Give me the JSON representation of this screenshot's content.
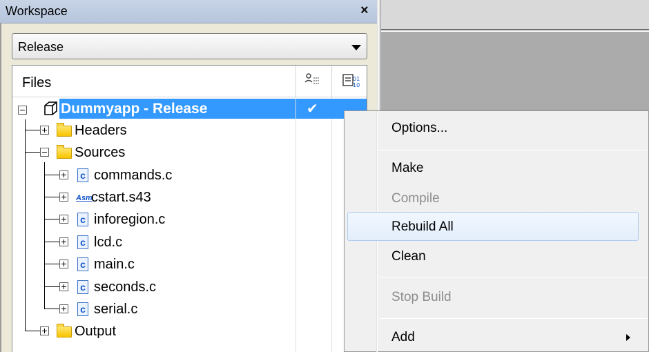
{
  "workspace": {
    "title": "Workspace",
    "close_glyph": "×",
    "configuration": "Release",
    "files_header": "Files",
    "project": {
      "label": "Dummyapp - Release",
      "checked": "✔"
    },
    "tree": [
      {
        "label": "Headers"
      },
      {
        "label": "Sources"
      },
      {
        "label": "commands.c"
      },
      {
        "label": "cstart.s43"
      },
      {
        "label": "inforegion.c"
      },
      {
        "label": "lcd.c"
      },
      {
        "label": "main.c"
      },
      {
        "label": "seconds.c"
      },
      {
        "label": "serial.c"
      },
      {
        "label": "Output"
      }
    ],
    "file_icon_glyph": "c",
    "asm_icon_glyph": "Asm"
  },
  "context_menu": {
    "items": [
      {
        "label": "Options...",
        "enabled": true
      },
      {
        "label": "Make",
        "enabled": true
      },
      {
        "label": "Compile",
        "enabled": false
      },
      {
        "label": "Rebuild All",
        "enabled": true,
        "highlighted": true
      },
      {
        "label": "Clean",
        "enabled": true
      },
      {
        "label": "Stop Build",
        "enabled": false
      },
      {
        "label": "Add",
        "enabled": true,
        "has_submenu": true
      }
    ]
  },
  "colors": {
    "selection": "#3399ff",
    "title_bar": "#c8d4e6",
    "disabled_text": "#8d8d8d",
    "folder": "#f7c400"
  }
}
